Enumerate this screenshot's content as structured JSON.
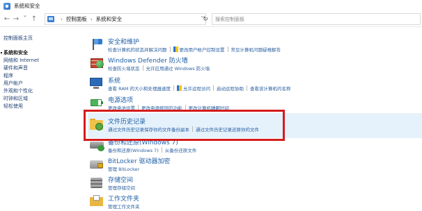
{
  "window": {
    "title": "系统和安全"
  },
  "address_bar": {
    "back": "←",
    "forward": "→",
    "recent": "˅",
    "up": "↑",
    "segments": [
      "控制面板",
      "系统和安全"
    ],
    "separator": "›",
    "dropdown": "˅",
    "refresh": "↻"
  },
  "search": {
    "placeholder": "搜索控制面板"
  },
  "sidebar": {
    "home": "控制面板主页",
    "items": [
      "系统和安全",
      "网络和 Internet",
      "硬件和声音",
      "程序",
      "用户帐户",
      "外观和个性化",
      "时钟和区域",
      "轻松使用"
    ],
    "active_index": 0
  },
  "categories": [
    {
      "title": "安全和维护",
      "links": [
        "检查计算机的状态并解决问题",
        "更改用户帐户控制设置",
        "常见计算机问题疑难解答"
      ],
      "shield_on_link": 1,
      "icon": "flag-icon"
    },
    {
      "title": "Windows Defender 防火墙",
      "links": [
        "检查防火墙状态",
        "允许应用通过 Windows 防火墙"
      ],
      "icon": "firewall-icon"
    },
    {
      "title": "系统",
      "links": [
        "查看 RAM 的大小和处理器速度",
        "允许远程访问",
        "启动远程协助",
        "查看该计算机的名称"
      ],
      "shield_on_link": 1,
      "icon": "system-icon"
    },
    {
      "title": "电源选项",
      "links": [
        "更改电池设置",
        "更改电源按钮的功能",
        "更改计算机睡眠时间"
      ],
      "icon": "battery-icon"
    },
    {
      "title": "文件历史记录",
      "links": [
        "通过文件历史记录保存你的文件备份副本",
        "通过文件历史记录还原你的文件"
      ],
      "icon": "file-history-icon"
    },
    {
      "title": "备份和还原(Windows 7)",
      "links": [
        "备份和还原(Windows 7)",
        "从备份还原文件"
      ],
      "icon": "backup-icon"
    },
    {
      "title": "BitLocker 驱动器加密",
      "links": [
        "管理 BitLocker"
      ],
      "icon": "bitlocker-icon"
    },
    {
      "title": "存储空间",
      "links": [
        "管理存储空间"
      ],
      "icon": "storage-icon"
    },
    {
      "title": "工作文件夹",
      "links": [
        "管理工作文件夹"
      ],
      "icon": "work-folders-icon"
    }
  ],
  "colors": {
    "link": "#1e5fa8",
    "highlight": "#e5f1fb",
    "annotation_box": "#d41b1b"
  }
}
